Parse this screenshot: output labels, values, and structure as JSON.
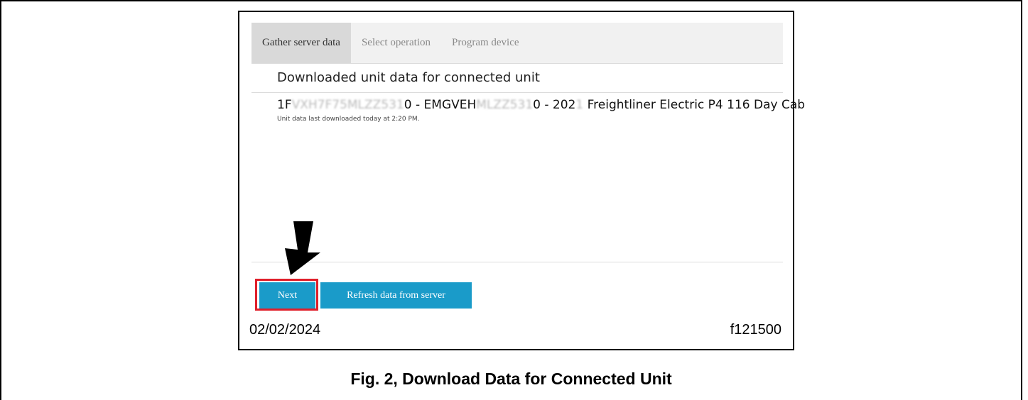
{
  "tabs": [
    {
      "label": "Gather server data",
      "active": true
    },
    {
      "label": "Select operation",
      "active": false
    },
    {
      "label": "Program device",
      "active": false
    }
  ],
  "heading": "Downloaded unit data for connected unit",
  "unit": {
    "vin_prefix": "1F",
    "vin_blurred": "VXH7F75MLZZ531",
    "vin_suffix": "0 - EMGVEH",
    "id_blurred": "MLZZ531",
    "id_suffix": "0 - 202",
    "year_blurred": "1",
    "model": " Freightliner Electric P4 116 Day Cab",
    "last_downloaded": "Unit data last downloaded today at 2:20 PM."
  },
  "buttons": {
    "next": "Next",
    "refresh": "Refresh data from server"
  },
  "footer": {
    "date": "02/02/2024",
    "code": "f121500"
  },
  "caption": "Fig. 2, Download Data for Connected Unit",
  "colors": {
    "button": "#1a9bc9",
    "highlight": "#e01f2a",
    "tab_active": "#d9d9d9"
  }
}
